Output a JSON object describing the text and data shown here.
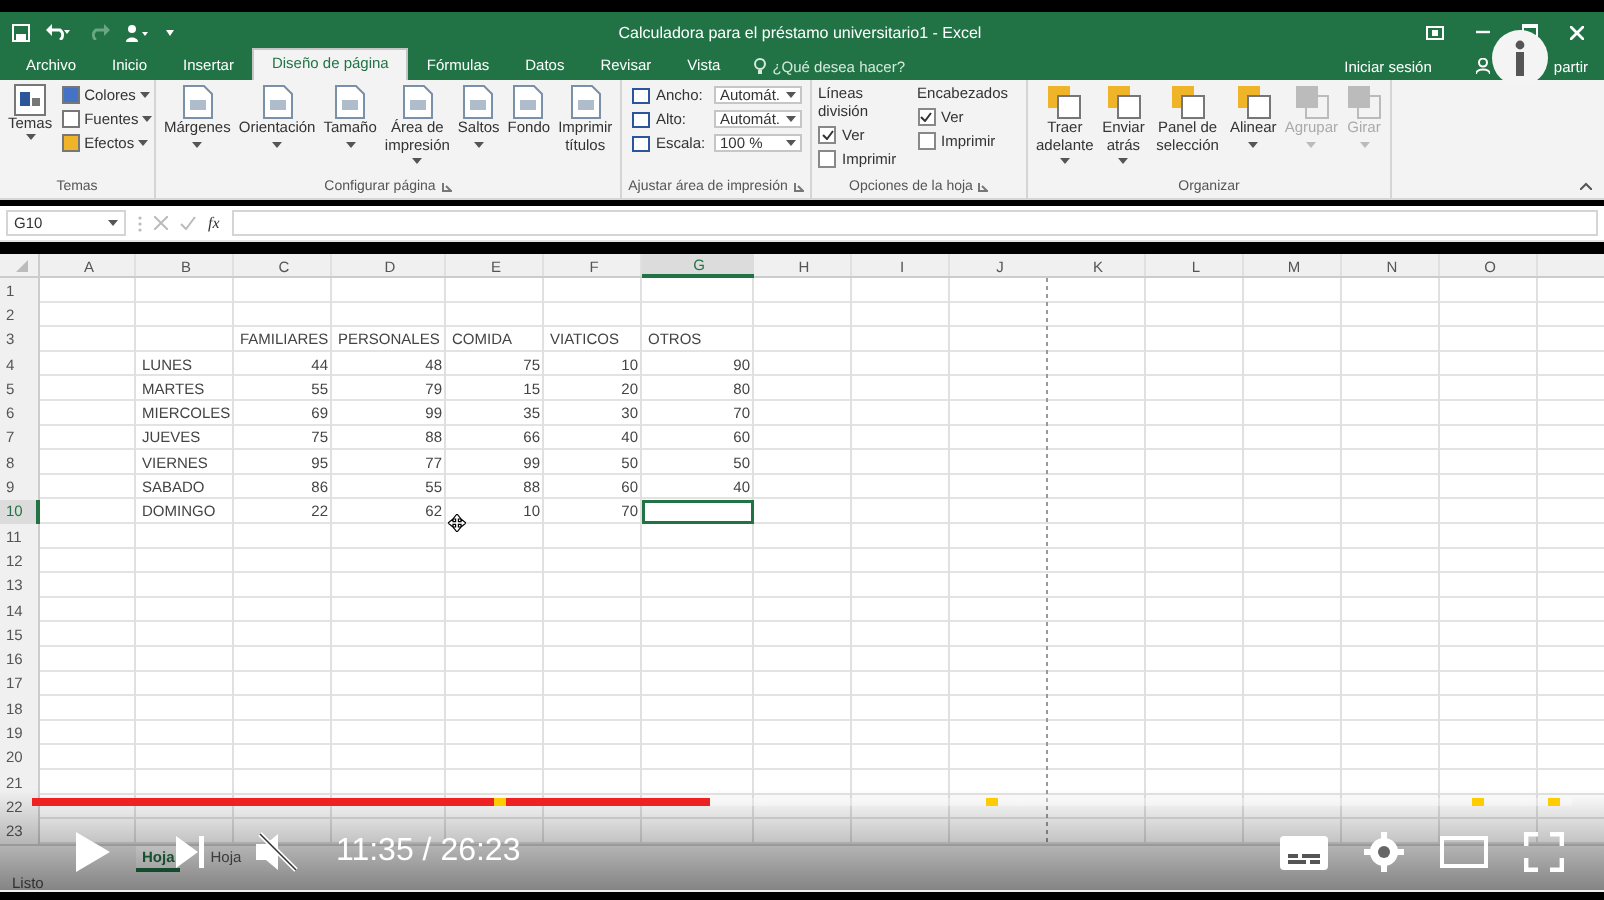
{
  "window": {
    "title": "Calculadora para el préstamo universitario1 - Excel"
  },
  "ribbon_tabs": [
    {
      "label": "Archivo",
      "selected": false
    },
    {
      "label": "Inicio",
      "selected": false
    },
    {
      "label": "Insertar",
      "selected": false
    },
    {
      "label": "Diseño de página",
      "selected": true
    },
    {
      "label": "Fórmulas",
      "selected": false
    },
    {
      "label": "Datos",
      "selected": false
    },
    {
      "label": "Revisar",
      "selected": false
    },
    {
      "label": "Vista",
      "selected": false
    }
  ],
  "tell_me": {
    "placeholder": "¿Qué desea hacer?"
  },
  "sign_in": "Iniciar sesión",
  "share": "partir",
  "ribbon": {
    "groups": [
      {
        "kind": "themes",
        "label": "Temas",
        "main": "Temas",
        "items": [
          "Colores",
          "Fuentes",
          "Efectos"
        ]
      },
      {
        "kind": "page_setup",
        "label": "Configurar página",
        "launcher": true,
        "buttons": [
          {
            "label": "Márgenes",
            "dropdown": true,
            "disabled": false
          },
          {
            "label": "Orientación",
            "dropdown": true,
            "disabled": false
          },
          {
            "label": "Tamaño",
            "dropdown": true,
            "disabled": false
          },
          {
            "label": "Área de impresión",
            "dropdown": true,
            "disabled": false
          },
          {
            "label": "Saltos",
            "dropdown": true,
            "disabled": false
          },
          {
            "label": "Fondo",
            "dropdown": false,
            "disabled": false
          },
          {
            "label": "Imprimir títulos",
            "dropdown": false,
            "disabled": false
          }
        ]
      },
      {
        "kind": "scale",
        "label": "Ajustar área de impresión",
        "launcher": true,
        "fields": [
          {
            "label": "Ancho:",
            "value": "Automát."
          },
          {
            "label": "Alto:",
            "value": "Automát."
          },
          {
            "label": "Escala:",
            "value": "100 %"
          }
        ]
      },
      {
        "kind": "options",
        "label": "Opciones de la hoja",
        "launcher": true,
        "columns": [
          {
            "title": "Líneas división",
            "options": [
              {
                "label": "Ver",
                "checked": true
              },
              {
                "label": "Imprimir",
                "checked": false
              }
            ]
          },
          {
            "title": "Encabezados",
            "options": [
              {
                "label": "Ver",
                "checked": true
              },
              {
                "label": "Imprimir",
                "checked": false
              }
            ]
          }
        ]
      },
      {
        "kind": "arrange",
        "label": "Organizar",
        "launcher": false,
        "buttons": [
          {
            "label": "Traer adelante",
            "dropdown": true,
            "disabled": false
          },
          {
            "label": "Enviar atrás",
            "dropdown": true,
            "disabled": false
          },
          {
            "label": "Panel de selección",
            "dropdown": false,
            "disabled": false
          },
          {
            "label": "Alinear",
            "dropdown": true,
            "disabled": false
          },
          {
            "label": "Agrupar",
            "dropdown": true,
            "disabled": true
          },
          {
            "label": "Girar",
            "dropdown": true,
            "disabled": true
          }
        ]
      }
    ]
  },
  "formula_bar": {
    "name_box": "G10",
    "function_button": "fx"
  },
  "sheet": {
    "columns": [
      {
        "label": "A",
        "selected": false
      },
      {
        "label": "B",
        "selected": false
      },
      {
        "label": "C",
        "selected": false
      },
      {
        "label": "D",
        "selected": false
      },
      {
        "label": "E",
        "selected": false
      },
      {
        "label": "F",
        "selected": false
      },
      {
        "label": "G",
        "selected": true
      },
      {
        "label": "H",
        "selected": false
      },
      {
        "label": "I",
        "selected": false
      },
      {
        "label": "J",
        "selected": false
      },
      {
        "label": "K",
        "selected": false
      },
      {
        "label": "L",
        "selected": false
      },
      {
        "label": "M",
        "selected": false
      },
      {
        "label": "N",
        "selected": false
      },
      {
        "label": "O",
        "selected": false
      }
    ],
    "rows": [
      {
        "label": "1",
        "selected": false
      },
      {
        "label": "2",
        "selected": false
      },
      {
        "label": "3",
        "selected": false
      },
      {
        "label": "4",
        "selected": false
      },
      {
        "label": "5",
        "selected": false
      },
      {
        "label": "6",
        "selected": false
      },
      {
        "label": "7",
        "selected": false
      },
      {
        "label": "8",
        "selected": false
      },
      {
        "label": "9",
        "selected": false
      },
      {
        "label": "10",
        "selected": true
      },
      {
        "label": "11",
        "selected": false
      },
      {
        "label": "12",
        "selected": false
      },
      {
        "label": "13",
        "selected": false
      },
      {
        "label": "14",
        "selected": false
      },
      {
        "label": "15",
        "selected": false
      },
      {
        "label": "16",
        "selected": false
      },
      {
        "label": "17",
        "selected": false
      },
      {
        "label": "18",
        "selected": false
      },
      {
        "label": "19",
        "selected": false
      },
      {
        "label": "20",
        "selected": false
      },
      {
        "label": "21",
        "selected": false
      },
      {
        "label": "22",
        "selected": false
      },
      {
        "label": "23",
        "selected": false
      }
    ],
    "table": {
      "header": [
        "FAMILIARES",
        "PERSONALES",
        "COMIDA",
        "VIATICOS",
        "OTROS"
      ],
      "rows": [
        {
          "label": "LUNES",
          "values": [
            "44",
            "48",
            "75",
            "10",
            "90"
          ]
        },
        {
          "label": "MARTES",
          "values": [
            "55",
            "79",
            "15",
            "20",
            "80"
          ]
        },
        {
          "label": "MIERCOLES",
          "values": [
            "69",
            "99",
            "35",
            "30",
            "70"
          ]
        },
        {
          "label": "JUEVES",
          "values": [
            "75",
            "88",
            "66",
            "40",
            "60"
          ]
        },
        {
          "label": "VIERNES",
          "values": [
            "95",
            "77",
            "99",
            "50",
            "50"
          ]
        },
        {
          "label": "SABADO",
          "values": [
            "86",
            "55",
            "88",
            "60",
            "40"
          ]
        },
        {
          "label": "DOMINGO",
          "values": [
            "22",
            "62",
            "10",
            "70"
          ]
        }
      ]
    }
  },
  "sheet_tabs": [
    {
      "label": "Hoja",
      "selected": true
    },
    {
      "label": "Hoja",
      "selected": false
    }
  ],
  "status_bar": {
    "text": "Listo"
  },
  "video_player": {
    "time": "11:35 / 26:23",
    "progress": {
      "level": 0.44
    },
    "muted": true
  }
}
